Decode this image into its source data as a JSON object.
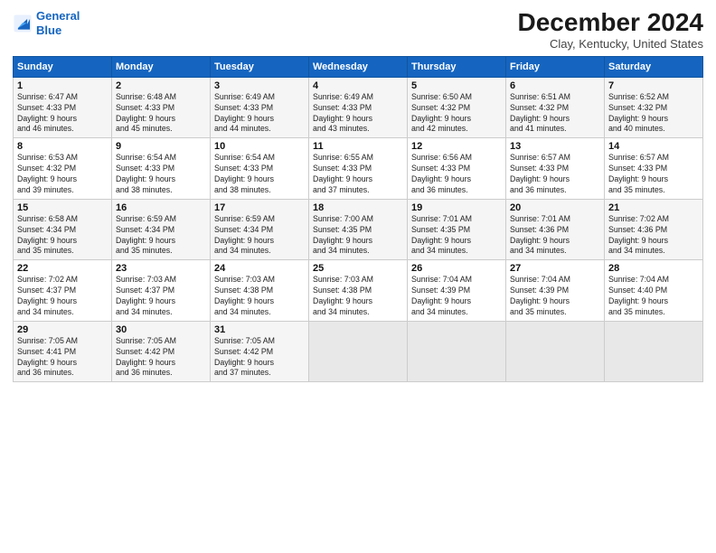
{
  "logo": {
    "line1": "General",
    "line2": "Blue"
  },
  "title": "December 2024",
  "subtitle": "Clay, Kentucky, United States",
  "days": [
    "Sunday",
    "Monday",
    "Tuesday",
    "Wednesday",
    "Thursday",
    "Friday",
    "Saturday"
  ],
  "weeks": [
    [
      {
        "day": 1,
        "sunrise": "6:47 AM",
        "sunset": "4:33 PM",
        "daylight": "9 hours and 46 minutes."
      },
      {
        "day": 2,
        "sunrise": "6:48 AM",
        "sunset": "4:33 PM",
        "daylight": "9 hours and 45 minutes."
      },
      {
        "day": 3,
        "sunrise": "6:49 AM",
        "sunset": "4:33 PM",
        "daylight": "9 hours and 44 minutes."
      },
      {
        "day": 4,
        "sunrise": "6:49 AM",
        "sunset": "4:33 PM",
        "daylight": "9 hours and 43 minutes."
      },
      {
        "day": 5,
        "sunrise": "6:50 AM",
        "sunset": "4:32 PM",
        "daylight": "9 hours and 42 minutes."
      },
      {
        "day": 6,
        "sunrise": "6:51 AM",
        "sunset": "4:32 PM",
        "daylight": "9 hours and 41 minutes."
      },
      {
        "day": 7,
        "sunrise": "6:52 AM",
        "sunset": "4:32 PM",
        "daylight": "9 hours and 40 minutes."
      }
    ],
    [
      {
        "day": 8,
        "sunrise": "6:53 AM",
        "sunset": "4:32 PM",
        "daylight": "9 hours and 39 minutes."
      },
      {
        "day": 9,
        "sunrise": "6:54 AM",
        "sunset": "4:33 PM",
        "daylight": "9 hours and 38 minutes."
      },
      {
        "day": 10,
        "sunrise": "6:54 AM",
        "sunset": "4:33 PM",
        "daylight": "9 hours and 38 minutes."
      },
      {
        "day": 11,
        "sunrise": "6:55 AM",
        "sunset": "4:33 PM",
        "daylight": "9 hours and 37 minutes."
      },
      {
        "day": 12,
        "sunrise": "6:56 AM",
        "sunset": "4:33 PM",
        "daylight": "9 hours and 36 minutes."
      },
      {
        "day": 13,
        "sunrise": "6:57 AM",
        "sunset": "4:33 PM",
        "daylight": "9 hours and 36 minutes."
      },
      {
        "day": 14,
        "sunrise": "6:57 AM",
        "sunset": "4:33 PM",
        "daylight": "9 hours and 35 minutes."
      }
    ],
    [
      {
        "day": 15,
        "sunrise": "6:58 AM",
        "sunset": "4:34 PM",
        "daylight": "9 hours and 35 minutes."
      },
      {
        "day": 16,
        "sunrise": "6:59 AM",
        "sunset": "4:34 PM",
        "daylight": "9 hours and 35 minutes."
      },
      {
        "day": 17,
        "sunrise": "6:59 AM",
        "sunset": "4:34 PM",
        "daylight": "9 hours and 34 minutes."
      },
      {
        "day": 18,
        "sunrise": "7:00 AM",
        "sunset": "4:35 PM",
        "daylight": "9 hours and 34 minutes."
      },
      {
        "day": 19,
        "sunrise": "7:01 AM",
        "sunset": "4:35 PM",
        "daylight": "9 hours and 34 minutes."
      },
      {
        "day": 20,
        "sunrise": "7:01 AM",
        "sunset": "4:36 PM",
        "daylight": "9 hours and 34 minutes."
      },
      {
        "day": 21,
        "sunrise": "7:02 AM",
        "sunset": "4:36 PM",
        "daylight": "9 hours and 34 minutes."
      }
    ],
    [
      {
        "day": 22,
        "sunrise": "7:02 AM",
        "sunset": "4:37 PM",
        "daylight": "9 hours and 34 minutes."
      },
      {
        "day": 23,
        "sunrise": "7:03 AM",
        "sunset": "4:37 PM",
        "daylight": "9 hours and 34 minutes."
      },
      {
        "day": 24,
        "sunrise": "7:03 AM",
        "sunset": "4:38 PM",
        "daylight": "9 hours and 34 minutes."
      },
      {
        "day": 25,
        "sunrise": "7:03 AM",
        "sunset": "4:38 PM",
        "daylight": "9 hours and 34 minutes."
      },
      {
        "day": 26,
        "sunrise": "7:04 AM",
        "sunset": "4:39 PM",
        "daylight": "9 hours and 34 minutes."
      },
      {
        "day": 27,
        "sunrise": "7:04 AM",
        "sunset": "4:39 PM",
        "daylight": "9 hours and 35 minutes."
      },
      {
        "day": 28,
        "sunrise": "7:04 AM",
        "sunset": "4:40 PM",
        "daylight": "9 hours and 35 minutes."
      }
    ],
    [
      {
        "day": 29,
        "sunrise": "7:05 AM",
        "sunset": "4:41 PM",
        "daylight": "9 hours and 36 minutes."
      },
      {
        "day": 30,
        "sunrise": "7:05 AM",
        "sunset": "4:42 PM",
        "daylight": "9 hours and 36 minutes."
      },
      {
        "day": 31,
        "sunrise": "7:05 AM",
        "sunset": "4:42 PM",
        "daylight": "9 hours and 37 minutes."
      },
      null,
      null,
      null,
      null
    ]
  ]
}
